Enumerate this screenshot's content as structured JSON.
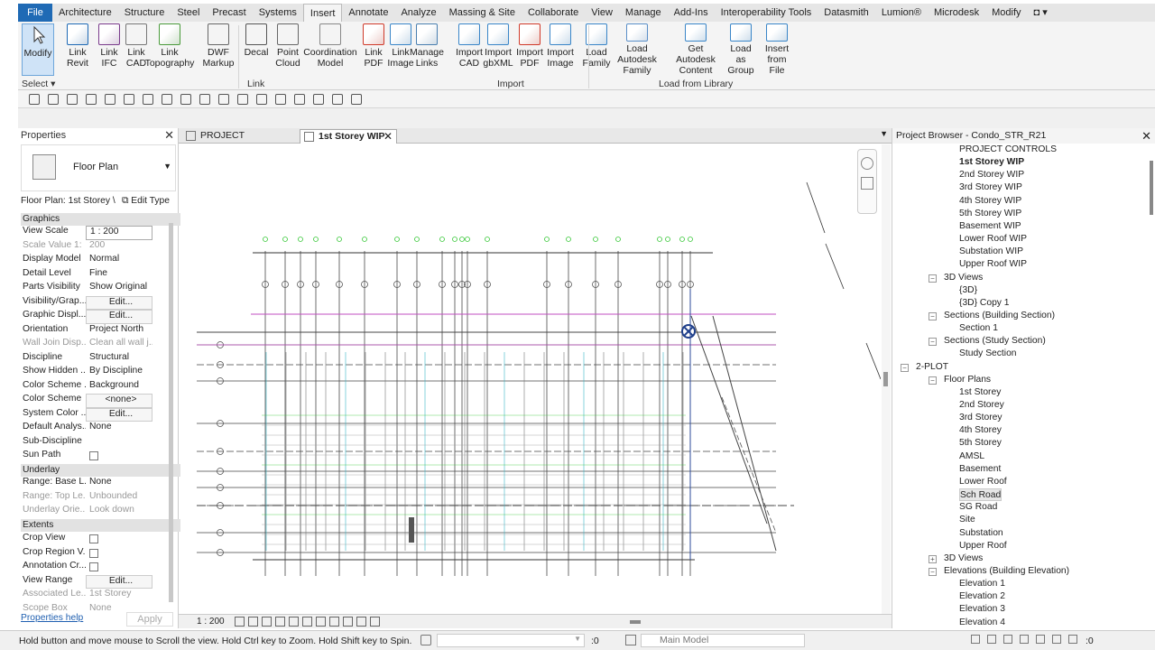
{
  "tabs": [
    "File",
    "Architecture",
    "Structure",
    "Steel",
    "Precast",
    "Systems",
    "Insert",
    "Annotate",
    "Analyze",
    "Massing & Site",
    "Collaborate",
    "View",
    "Manage",
    "Add-Ins",
    "Interoperability Tools",
    "Datasmith",
    "Lumion®",
    "Microdesk",
    "Modify"
  ],
  "ribbon": {
    "modify": "Modify",
    "select": "Select",
    "link_panel": "Link",
    "import_panel": "Import",
    "library_panel": "Load from Library",
    "buttons": [
      {
        "l1": "Link",
        "l2": "Revit",
        "icon": "link-revit-icon"
      },
      {
        "l1": "Link",
        "l2": "IFC",
        "icon": "link-ifc-icon"
      },
      {
        "l1": "Link",
        "l2": "CAD",
        "icon": "link-cad-icon"
      },
      {
        "l1": "Link",
        "l2": "Topography",
        "icon": "link-topography-icon"
      },
      {
        "l1": "DWF",
        "l2": "Markup",
        "icon": "dwf-markup-icon"
      },
      {
        "l1": "Decal",
        "l2": "",
        "icon": "decal-icon"
      },
      {
        "l1": "Point",
        "l2": "Cloud",
        "icon": "point-cloud-icon"
      },
      {
        "l1": "Coordination",
        "l2": "Model",
        "icon": "coordination-model-icon"
      },
      {
        "l1": "Link",
        "l2": "PDF",
        "icon": "link-pdf-icon"
      },
      {
        "l1": "Link",
        "l2": "Image",
        "icon": "link-image-icon"
      },
      {
        "l1": "Manage",
        "l2": "Links",
        "icon": "manage-links-icon"
      },
      {
        "l1": "Import",
        "l2": "CAD",
        "icon": "import-cad-icon"
      },
      {
        "l1": "Import",
        "l2": "gbXML",
        "icon": "import-gbxml-icon"
      },
      {
        "l1": "Import",
        "l2": "PDF",
        "icon": "import-pdf-icon"
      },
      {
        "l1": "Import",
        "l2": "Image",
        "icon": "import-image-icon"
      },
      {
        "l1": "Load",
        "l2": "Family",
        "icon": "load-family-icon"
      },
      {
        "l1": "Load Autodesk",
        "l2": "Family",
        "icon": "load-autodesk-family-icon"
      },
      {
        "l1": "Get Autodesk",
        "l2": "Content",
        "icon": "get-autodesk-content-icon"
      },
      {
        "l1": "Load as",
        "l2": "Group",
        "icon": "load-as-group-icon"
      },
      {
        "l1": "Insert",
        "l2": "from File",
        "icon": "insert-from-file-icon"
      }
    ]
  },
  "properties": {
    "title": "Properties",
    "type_name": "Floor Plan",
    "selector": "Floor Plan: 1st Storey \\",
    "edit_type": "Edit Type",
    "help": "Properties help",
    "apply": "Apply",
    "groups": {
      "graphics": "Graphics",
      "underlay": "Underlay",
      "extents": "Extents"
    },
    "graphics": [
      {
        "k": "View Scale",
        "v": "1 : 200"
      },
      {
        "k": "Scale Value   1:",
        "v": "200",
        "dim": true
      },
      {
        "k": "Display Model",
        "v": "Normal"
      },
      {
        "k": "Detail Level",
        "v": "Fine"
      },
      {
        "k": "Parts Visibility",
        "v": "Show Original"
      },
      {
        "k": "Visibility/Grap...",
        "v": "Edit...",
        "btn": true
      },
      {
        "k": "Graphic Displ...",
        "v": "Edit...",
        "btn": true
      },
      {
        "k": "Orientation",
        "v": "Project North"
      },
      {
        "k": "Wall Join Disp...",
        "v": "Clean all wall j...",
        "dim": true
      },
      {
        "k": "Discipline",
        "v": "Structural"
      },
      {
        "k": "Show Hidden ...",
        "v": "By Discipline"
      },
      {
        "k": "Color Scheme ...",
        "v": "Background"
      },
      {
        "k": "Color Scheme",
        "v": "<none>",
        "btn": true
      },
      {
        "k": "System Color ...",
        "v": "Edit...",
        "btn": true
      },
      {
        "k": "Default Analys...",
        "v": "None"
      },
      {
        "k": "Sub-Discipline",
        "v": ""
      },
      {
        "k": "Sun Path",
        "v": "",
        "chk": true
      }
    ],
    "underlay": [
      {
        "k": "Range: Base L...",
        "v": "None"
      },
      {
        "k": "Range: Top Le...",
        "v": "Unbounded",
        "dim": true
      },
      {
        "k": "Underlay Orie...",
        "v": "Look down",
        "dim": true
      }
    ],
    "extents": [
      {
        "k": "Crop View",
        "v": "",
        "chk": true
      },
      {
        "k": "Crop Region V...",
        "v": "",
        "chk": true
      },
      {
        "k": "Annotation Cr...",
        "v": "",
        "chk": true
      },
      {
        "k": "View Range",
        "v": "Edit...",
        "btn": true
      },
      {
        "k": "Associated Le...",
        "v": "1st Storey",
        "dim": true
      },
      {
        "k": "Scope Box",
        "v": "None",
        "dim": true
      }
    ]
  },
  "views": {
    "tab1": "PROJECT CONTROLS",
    "tab2": "1st Storey WIP",
    "scale": "1 : 200"
  },
  "browser": {
    "title": "Project Browser - Condo_STR_R21",
    "items": [
      {
        "t": "PROJECT CONTROLS",
        "lv": 3
      },
      {
        "t": "1st Storey WIP",
        "lv": 3,
        "bold": true
      },
      {
        "t": "2nd Storey WIP",
        "lv": 3
      },
      {
        "t": "3rd Storey WIP",
        "lv": 3
      },
      {
        "t": "4th Storey WIP",
        "lv": 3
      },
      {
        "t": "5th Storey WIP",
        "lv": 3
      },
      {
        "t": "Basement WIP",
        "lv": 3
      },
      {
        "t": "Lower Roof WIP",
        "lv": 3
      },
      {
        "t": "Substation WIP",
        "lv": 3
      },
      {
        "t": "Upper Roof WIP",
        "lv": 3
      },
      {
        "t": "3D Views",
        "lv": 2,
        "tg": "−"
      },
      {
        "t": "{3D}",
        "lv": 3
      },
      {
        "t": "{3D} Copy 1",
        "lv": 3
      },
      {
        "t": "Sections (Building Section)",
        "lv": 2,
        "tg": "−"
      },
      {
        "t": "Section 1",
        "lv": 3
      },
      {
        "t": "Sections (Study Section)",
        "lv": 2,
        "tg": "−"
      },
      {
        "t": "Study Section",
        "lv": 3
      },
      {
        "t": "2-PLOT",
        "lv": 1,
        "tg": "−"
      },
      {
        "t": "Floor Plans",
        "lv": 2,
        "tg": "−"
      },
      {
        "t": "1st Storey",
        "lv": 3
      },
      {
        "t": "2nd Storey",
        "lv": 3
      },
      {
        "t": "3rd Storey",
        "lv": 3
      },
      {
        "t": "4th Storey",
        "lv": 3
      },
      {
        "t": "5th Storey",
        "lv": 3
      },
      {
        "t": "AMSL",
        "lv": 3
      },
      {
        "t": "Basement",
        "lv": 3
      },
      {
        "t": "Lower Roof",
        "lv": 3
      },
      {
        "t": "Sch Road",
        "lv": 3,
        "sel": true
      },
      {
        "t": "SG Road",
        "lv": 3
      },
      {
        "t": "Site",
        "lv": 3
      },
      {
        "t": "Substation",
        "lv": 3
      },
      {
        "t": "Upper Roof",
        "lv": 3
      },
      {
        "t": "3D Views",
        "lv": 2,
        "tg": "+"
      },
      {
        "t": "Elevations (Building Elevation)",
        "lv": 2,
        "tg": "−"
      },
      {
        "t": "Elevation 1",
        "lv": 3
      },
      {
        "t": "Elevation 2",
        "lv": 3
      },
      {
        "t": "Elevation 3",
        "lv": 3
      },
      {
        "t": "Elevation 4",
        "lv": 3
      }
    ]
  },
  "status": {
    "message": "Hold button and move mouse to Scroll the view. Hold Ctrl key to Zoom. Hold Shift key to Spin.",
    "zero1": ":0",
    "model": "Main Model",
    "zero2": ":0"
  },
  "colors": {
    "file_tab": "#1f6ab5",
    "selected": "#cfe3f7",
    "grid": "#4a4a4a",
    "accent_green": "#37c837",
    "accent_magenta": "#c04fc0",
    "accent_cyan": "#38b6c8"
  }
}
